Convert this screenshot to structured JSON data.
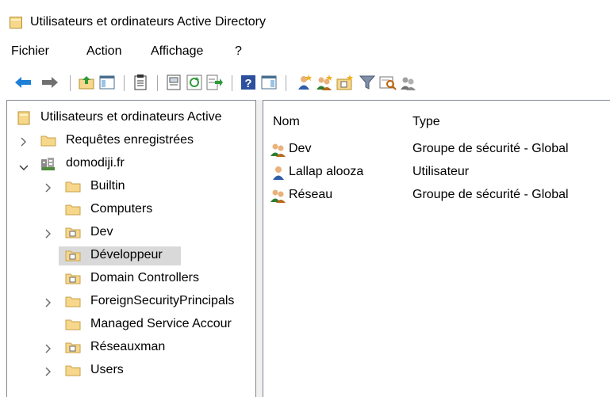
{
  "window": {
    "title": "Utilisateurs et ordinateurs Active Directory"
  },
  "menu": [
    "Fichier",
    "Action",
    "Affichage",
    "?"
  ],
  "toolbar": {
    "icons": [
      "back-icon",
      "forward-icon",
      "up-folder-icon",
      "show-console-tree-icon",
      "properties-icon",
      "export-list-icon",
      "refresh-icon",
      "export-icon",
      "help-icon",
      "show-pane-icon",
      "new-user-icon",
      "new-group-icon",
      "new-ou-icon",
      "filter-icon",
      "find-icon",
      "delegate-icon"
    ]
  },
  "tree": {
    "root": "Utilisateurs et ordinateurs Active",
    "saved_queries": "Requêtes enregistrées",
    "domain": "domodiji.fr",
    "children": [
      {
        "label": "Builtin",
        "expandable": true,
        "type": "container"
      },
      {
        "label": "Computers",
        "expandable": false,
        "type": "container"
      },
      {
        "label": "Dev",
        "expandable": true,
        "type": "ou"
      },
      {
        "label": "Développeur",
        "expandable": false,
        "type": "ou",
        "selected": true
      },
      {
        "label": "Domain Controllers",
        "expandable": false,
        "type": "ou"
      },
      {
        "label": "ForeignSecurityPrincipals",
        "expandable": true,
        "type": "container"
      },
      {
        "label": "Managed Service Accour",
        "expandable": false,
        "type": "container"
      },
      {
        "label": "Réseauxman",
        "expandable": true,
        "type": "ou"
      },
      {
        "label": "Users",
        "expandable": true,
        "type": "container"
      }
    ]
  },
  "list": {
    "columns": [
      "Nom",
      "Type"
    ],
    "rows": [
      {
        "name": "Dev",
        "type": "Groupe de sécurité - Global",
        "icon": "group-icon"
      },
      {
        "name": "Lallap alooza",
        "type": "Utilisateur",
        "icon": "user-icon"
      },
      {
        "name": "Réseau",
        "type": "Groupe de sécurité - Global",
        "icon": "group-icon"
      }
    ]
  },
  "colors": {
    "folder": "#f6d78b",
    "selection": "#d9d9d9",
    "back_arrow": "#1e7fd8"
  }
}
